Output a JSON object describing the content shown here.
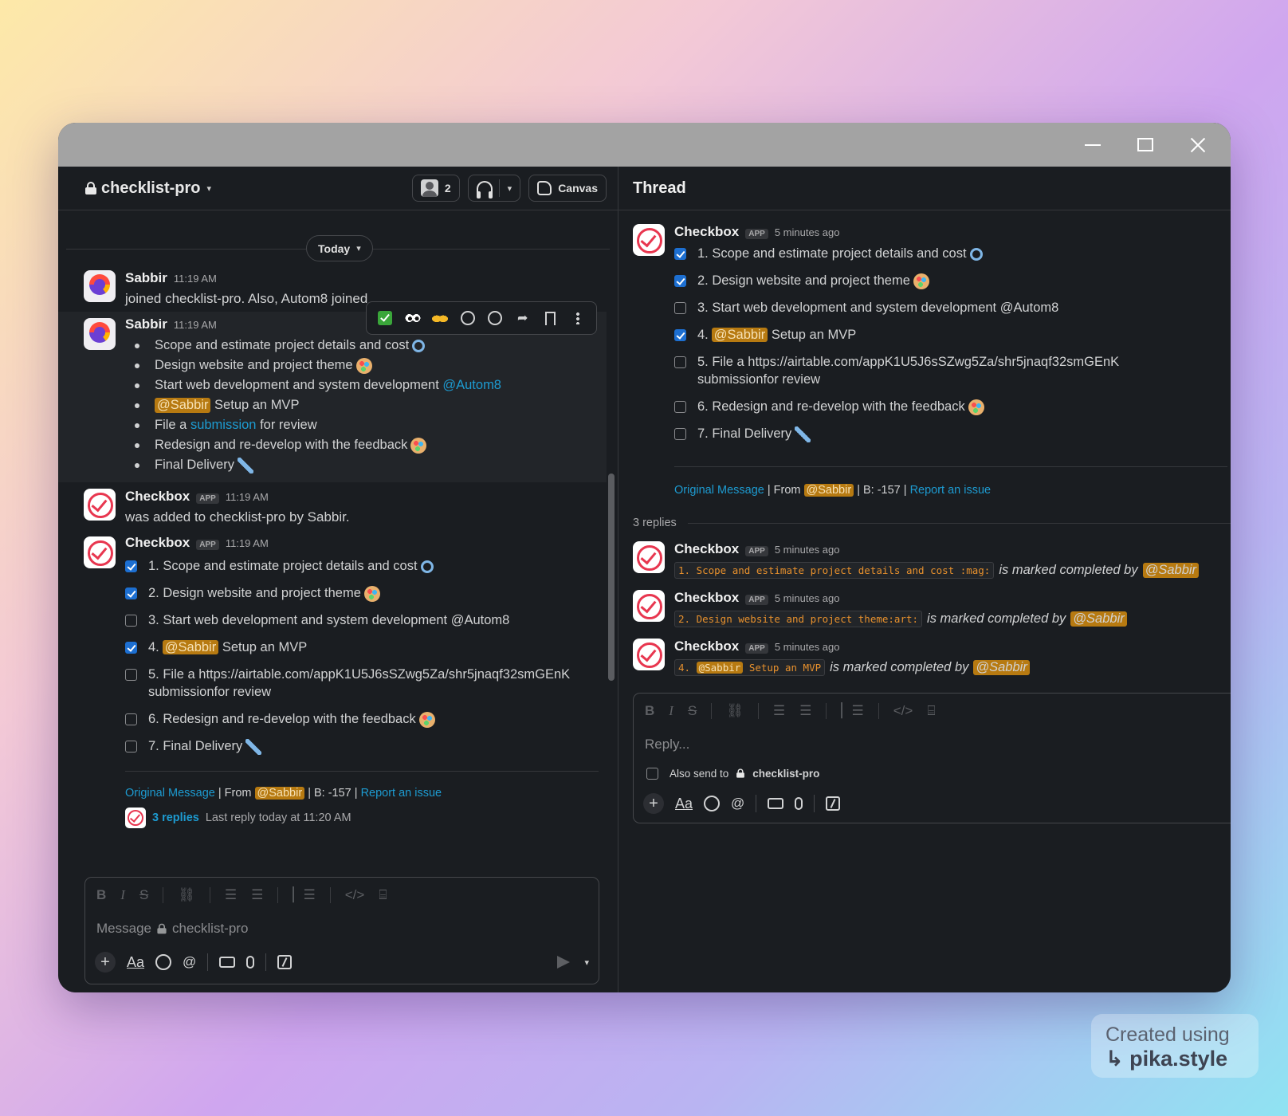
{
  "window": {
    "controls": [
      "minimize",
      "maximize",
      "close"
    ]
  },
  "channel": {
    "name": "checklist-pro",
    "member_count": "2",
    "canvas_label": "Canvas",
    "today_label": "Today"
  },
  "messages": {
    "m1": {
      "author": "Sabbir",
      "time": "11:19 AM",
      "text": "joined checklist-pro. Also, Autom8 joined"
    },
    "m2": {
      "author": "Sabbir",
      "time": "11:19 AM",
      "b1": "Scope and estimate project details and cost",
      "b2": "Design website and project theme",
      "b3": "Start web development and system development",
      "b3_mention": "@Autom8",
      "b4_mention": "@Sabbir",
      "b4": "Setup an MVP",
      "b5_pre": "File a",
      "b5_link": "submission",
      "b5_post": "for review",
      "b6": "Redesign and re-develop with the feedback",
      "b7": "Final Delivery"
    },
    "m3": {
      "author": "Checkbox",
      "badge": "APP",
      "time": "11:19 AM",
      "text": "was added to checklist-pro by Sabbir."
    },
    "m4": {
      "author": "Checkbox",
      "badge": "APP",
      "time": "11:19 AM",
      "items": {
        "i1": "1. Scope and estimate project details and cost",
        "i2": "2. Design website and project theme",
        "i3": "3. Start web development and system development @Autom8",
        "i4_num": "4.",
        "i4_mention": "@Sabbir",
        "i4": "Setup an MVP",
        "i5a": "5. File a https://airtable.com/appK1U5J6sSZwg5Za/shr5jnaqf32smGEnK",
        "i5b": "submissionfor review",
        "i6": "6. Redesign and re-develop with the feedback",
        "i7": "7. Final Delivery"
      },
      "checked": [
        true,
        true,
        false,
        true,
        false,
        false,
        false
      ],
      "footer": {
        "original": "Original Message",
        "from": "| From",
        "mention": "@Sabbir",
        "b": "| B: -157 |",
        "report": "Report an issue"
      },
      "replies": "3 replies",
      "last_reply": "Last reply today at 11:20 AM"
    }
  },
  "composer": {
    "placeholder": "Message",
    "channel": "checklist-pro",
    "aa": "Aa"
  },
  "thread": {
    "title": "Thread",
    "root": {
      "author": "Checkbox",
      "badge": "APP",
      "time": "5 minutes ago"
    },
    "reply_count": "3 replies",
    "replies": [
      {
        "author": "Checkbox",
        "badge": "APP",
        "time": "5 minutes ago",
        "code": "1. Scope and estimate project details and cost :mag:",
        "text": "is marked completed by",
        "mention": "@Sabbir"
      },
      {
        "author": "Checkbox",
        "badge": "APP",
        "time": "5 minutes ago",
        "code": "2. Design website and project theme:art:",
        "text": "is marked completed by",
        "mention": "@Sabbir"
      },
      {
        "author": "Checkbox",
        "badge": "APP",
        "time": "5 minutes ago",
        "code_pre": "4.",
        "code_mention": "@Sabbir",
        "code": "Setup an MVP",
        "text": "is marked completed by",
        "mention": "@Sabbir"
      }
    ],
    "reply_placeholder": "Reply...",
    "also_send": "Also send to",
    "also_send_channel": "checklist-pro"
  },
  "watermark": {
    "line1": "Created using",
    "line2": "pika.style"
  }
}
